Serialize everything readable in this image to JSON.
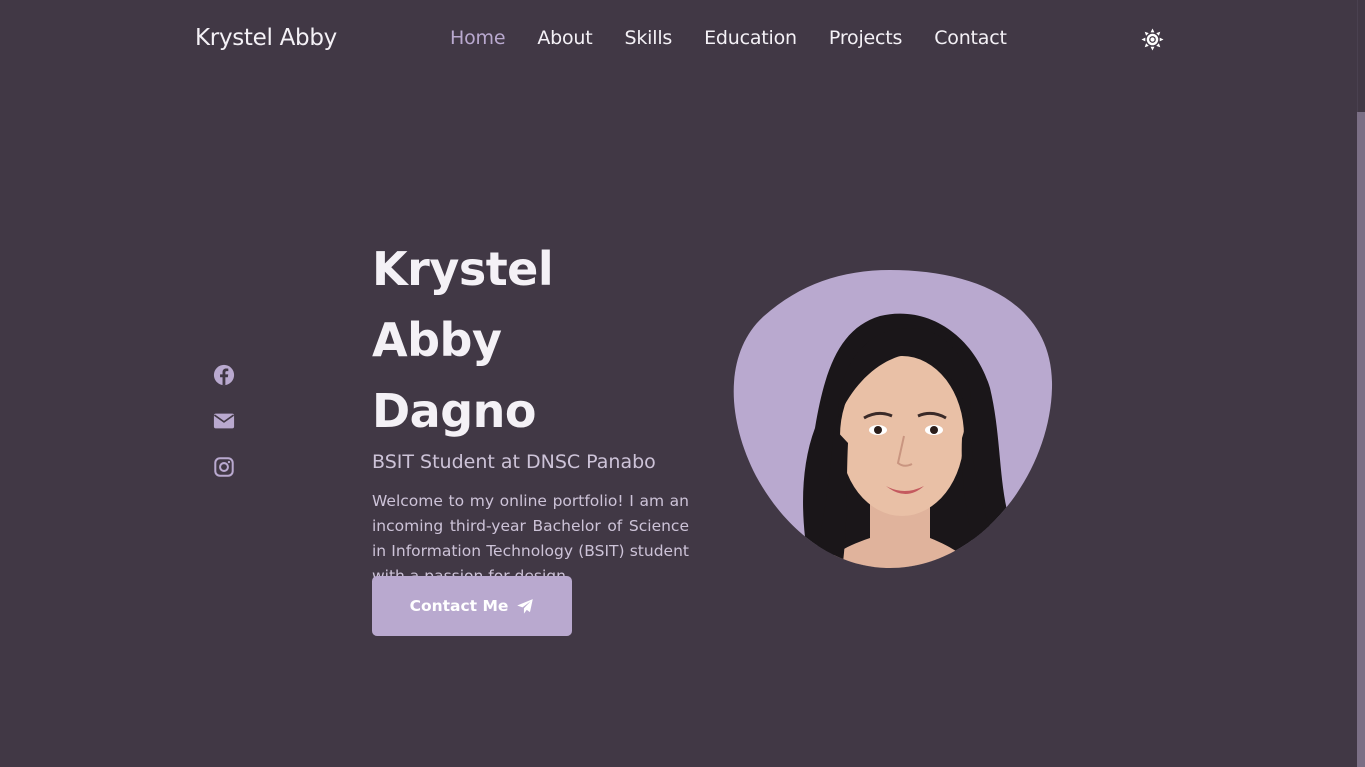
{
  "header": {
    "logo": "Krystel Abby",
    "nav": [
      {
        "label": "Home",
        "active": true
      },
      {
        "label": "About"
      },
      {
        "label": "Skills"
      },
      {
        "label": "Education"
      },
      {
        "label": "Projects"
      },
      {
        "label": "Contact"
      }
    ],
    "theme_icon": "sun-icon"
  },
  "social": [
    "facebook-icon",
    "envelope-icon",
    "instagram-icon"
  ],
  "hero": {
    "title_line1": "Krystel Abby",
    "title_line2": "Dagno",
    "subtitle": "BSIT Student at DNSC Panabo",
    "description": "Welcome to my online portfolio! I am an incoming third-year Bachelor of Science in Information Technology (BSIT) student with a passion for design.",
    "button_label": "Contact Me",
    "button_icon": "paper-plane-icon"
  },
  "colors": {
    "background": "#413845",
    "accent": "#b9a9cf",
    "text": "#f4f1f6",
    "muted_text": "#cdc3d8"
  }
}
